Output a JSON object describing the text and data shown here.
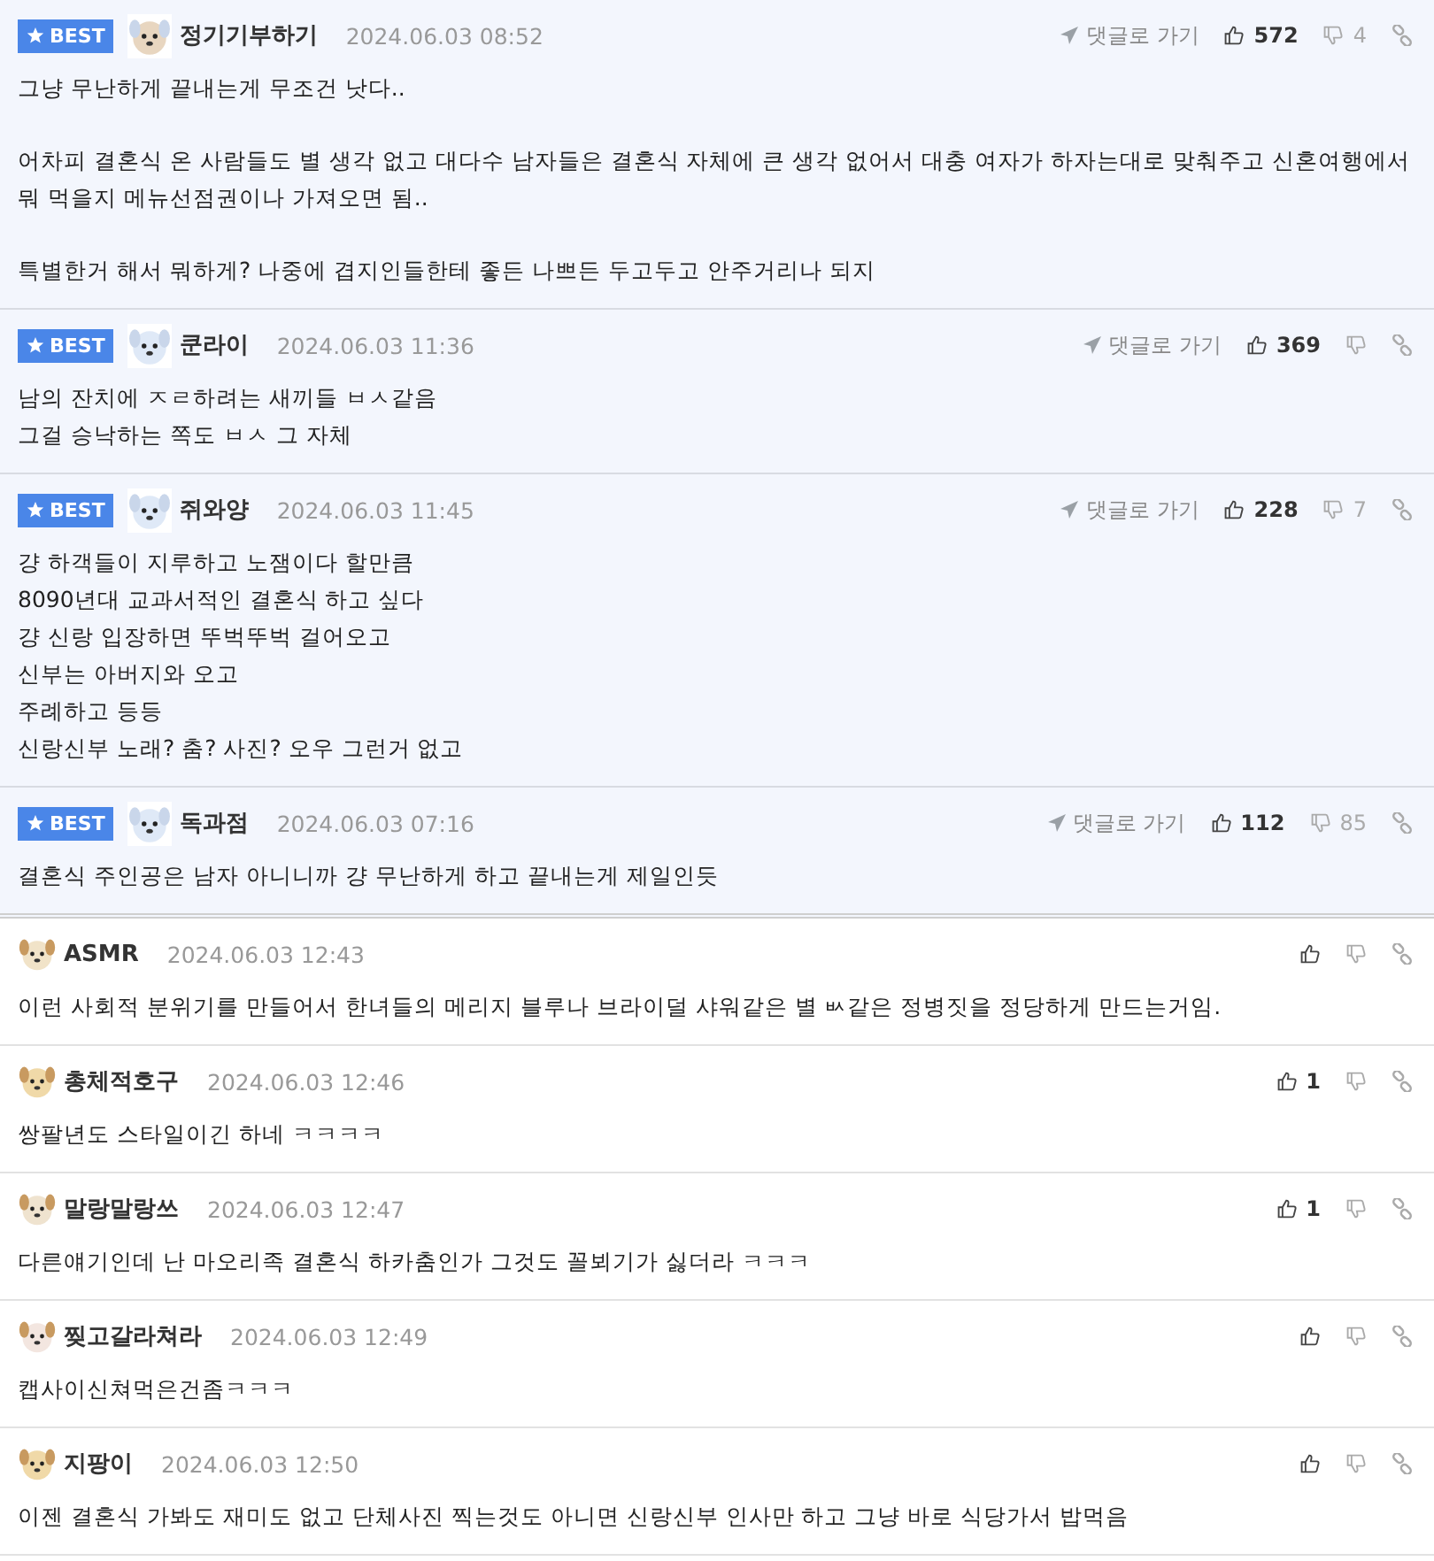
{
  "comments": [
    {
      "best": true,
      "badge": "BEST",
      "author": "정기기부하기",
      "date": "2024.06.03 08:52",
      "goto": "댓글로 가기",
      "likes": "572",
      "dislikes": "4",
      "paragraphs": [
        [
          "그냥 무난하게 끝내는게 무조건 낫다.."
        ],
        [
          "어차피 결혼식 온 사람들도 별 생각 없고 대다수 남자들은 결혼식 자체에 큰 생각 없어서 대충 여자가 하자는대로 맞춰주고 신혼여행에서 뭐 먹을지 메뉴선점권이나 가져오면 됨.."
        ],
        [
          "특별한거 해서 뭐하게? 나중에 겹지인들한테 좋든 나쁘든 두고두고 안주거리나 되지"
        ]
      ]
    },
    {
      "best": true,
      "badge": "BEST",
      "author": "쿤라이",
      "date": "2024.06.03 11:36",
      "goto": "댓글로 가기",
      "likes": "369",
      "paragraphs": [
        [
          "남의 잔치에 ㅈㄹ하려는 새끼들 ㅂㅅ같음",
          "그걸 승낙하는 쪽도 ㅂㅅ 그 자체"
        ]
      ]
    },
    {
      "best": true,
      "badge": "BEST",
      "author": "쥐와양",
      "date": "2024.06.03 11:45",
      "goto": "댓글로 가기",
      "likes": "228",
      "dislikes": "7",
      "paragraphs": [
        [
          "걍 하객들이 지루하고 노잼이다 할만큼",
          "8090년대 교과서적인 결혼식 하고 싶다",
          "걍 신랑 입장하면 뚜벅뚜벅 걸어오고",
          "신부는 아버지와 오고",
          "주례하고 등등",
          "신랑신부 노래? 춤? 사진? 오우 그런거 없고"
        ]
      ]
    },
    {
      "best": true,
      "badge": "BEST",
      "author": "독과점",
      "date": "2024.06.03 07:16",
      "goto": "댓글로 가기",
      "likes": "112",
      "dislikes": "85",
      "paragraphs": [
        [
          "결혼식 주인공은 남자 아니니까 걍 무난하게 하고 끝내는게 제일인듯"
        ]
      ]
    },
    {
      "best": false,
      "author": "ASMR",
      "date": "2024.06.03 12:43",
      "paragraphs": [
        [
          "이런 사회적 분위기를 만들어서 한녀들의 메리지 블루나 브라이덜 샤워같은 별 ㅄ같은 정병짓을 정당하게 만드는거임."
        ]
      ]
    },
    {
      "best": false,
      "author": "총체적호구",
      "date": "2024.06.03 12:46",
      "likes": "1",
      "paragraphs": [
        [
          "쌍팔년도 스타일이긴 하네 ㅋㅋㅋㅋ"
        ]
      ]
    },
    {
      "best": false,
      "author": "말랑말랑쓰",
      "date": "2024.06.03 12:47",
      "likes": "1",
      "paragraphs": [
        [
          "다른얘기인데 난 마오리족 결혼식 하카춤인가 그것도 꼴뵈기가 싫더라 ㅋㅋㅋ"
        ]
      ]
    },
    {
      "best": false,
      "author": "찢고갈라쳐라",
      "date": "2024.06.03 12:49",
      "paragraphs": [
        [
          "캡사이신쳐먹은건좀ㅋㅋㅋ"
        ]
      ]
    },
    {
      "best": false,
      "author": "지팡이",
      "date": "2024.06.03 12:50",
      "paragraphs": [
        [
          "이젠 결혼식 가봐도 재미도 없고 단체사진 찍는것도 아니면 신랑신부 인사만 하고 그냥 바로 식당가서 밥먹음"
        ]
      ]
    }
  ]
}
